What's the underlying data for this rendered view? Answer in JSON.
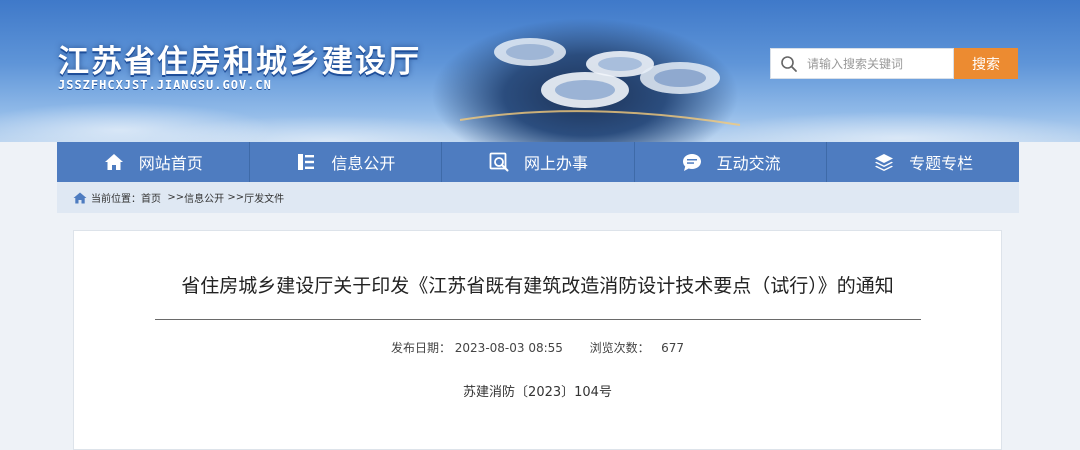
{
  "header": {
    "site_title": "江苏省住房和城乡建设厅",
    "site_url": "JSSZFHCXJST.JIANGSU.GOV.CN",
    "search": {
      "placeholder": "请输入搜索关键词",
      "value": "",
      "button_label": "搜索",
      "icon": "search-icon"
    }
  },
  "nav": {
    "items": [
      {
        "label": "网站首页",
        "icon": "home-icon"
      },
      {
        "label": "信息公开",
        "icon": "document-list-icon"
      },
      {
        "label": "网上办事",
        "icon": "online-service-icon"
      },
      {
        "label": "互动交流",
        "icon": "chat-bubble-icon"
      },
      {
        "label": "专题专栏",
        "icon": "layers-icon"
      }
    ]
  },
  "breadcrumb": {
    "prefix": "当前位置：",
    "items": [
      "首页",
      "信息公开",
      "厅发文件"
    ],
    "separator": ">>"
  },
  "article": {
    "title": "省住房城乡建设厅关于印发《江苏省既有建筑改造消防设计技术要点（试行）》的通知",
    "publish_label": "发布日期：",
    "publish_date": "2023-08-03 08:55",
    "views_label": "浏览次数：",
    "views": "677",
    "doc_number": "苏建消防〔2023〕104号"
  },
  "colors": {
    "nav_bg": "#4e7cc0",
    "search_button": "#ec8b31",
    "breadcrumb_bg": "#dfe8f3",
    "page_bg": "#eef2f7"
  }
}
